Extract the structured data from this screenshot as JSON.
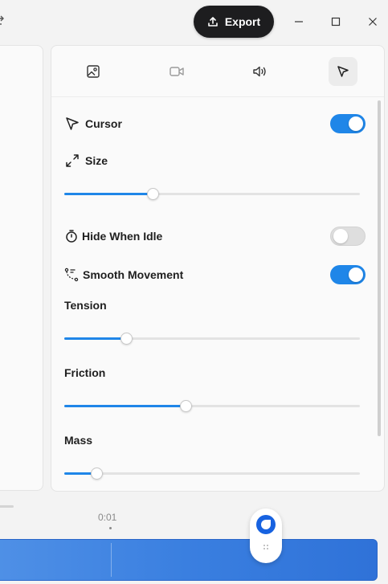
{
  "titlebar": {
    "export_label": "Export"
  },
  "tabs": [
    {
      "name": "image",
      "icon": "image-icon"
    },
    {
      "name": "video",
      "icon": "video-camera-icon"
    },
    {
      "name": "audio",
      "icon": "speaker-icon"
    },
    {
      "name": "cursor",
      "icon": "cursor-pointer-icon",
      "active": true
    }
  ],
  "cursor_settings": {
    "cursor_label": "Cursor",
    "cursor_enabled": true,
    "size_label": "Size",
    "size_value": 0.3,
    "hide_when_idle_label": "Hide When Idle",
    "hide_when_idle_enabled": false,
    "smooth_movement_label": "Smooth Movement",
    "smooth_movement_enabled": true,
    "tension_label": "Tension",
    "tension_value": 0.21,
    "friction_label": "Friction",
    "friction_value": 0.41,
    "mass_label": "Mass",
    "mass_value": 0.11
  },
  "timeline": {
    "time_label": "0:01"
  },
  "colors": {
    "accent": "#1f86e8",
    "export_bg": "#1d1d1f",
    "clip": "#3a7fe0",
    "playhead": "#1762e0"
  }
}
